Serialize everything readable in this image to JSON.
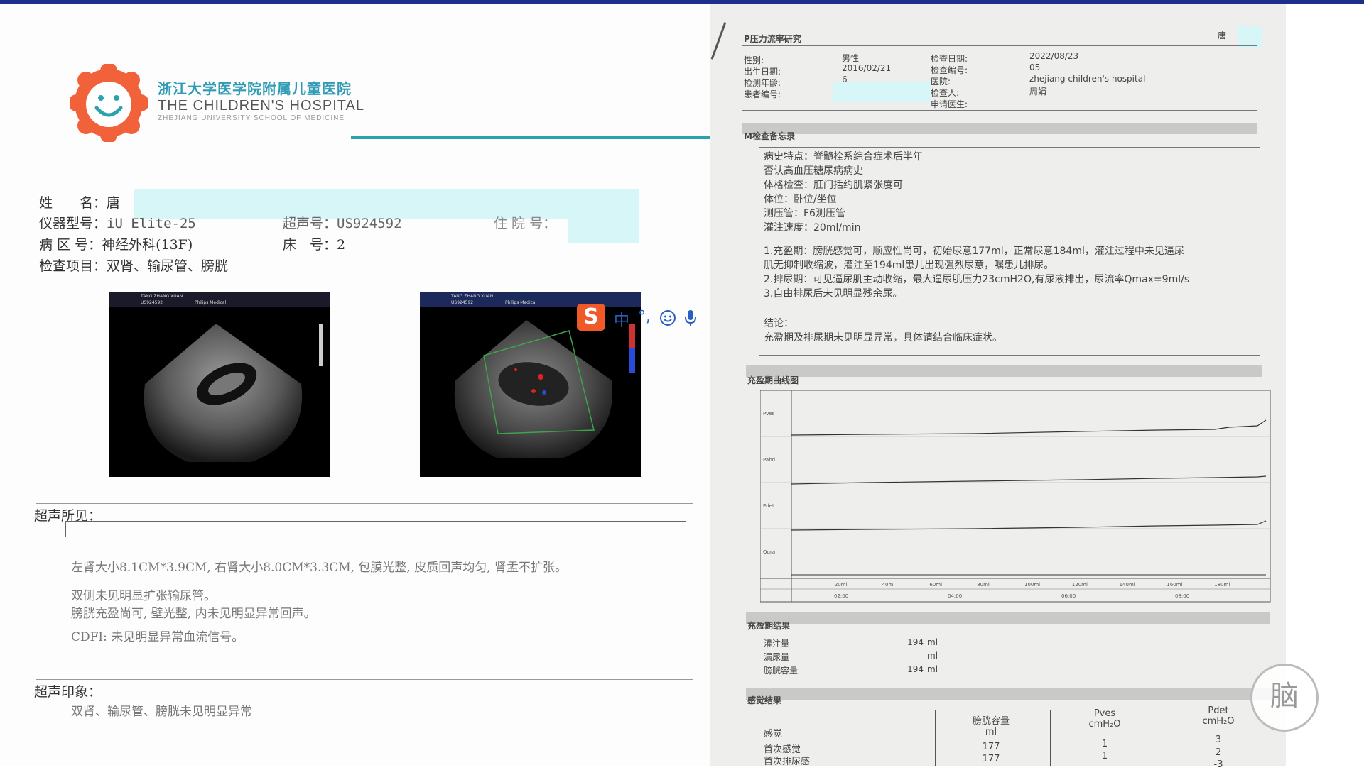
{
  "hospital": {
    "name_cn": "浙江大学医学院附属儿童医院",
    "name_en": "THE CHILDREN'S HOSPITAL",
    "school_en": "ZHEJIANG UNIVERSITY SCHOOL OF MEDICINE"
  },
  "report": {
    "name_label": "姓　　名：",
    "name_value": "唐",
    "device_label": "仪器型号：",
    "device_value": "iU Elite-25",
    "us_no_label": "超声号：",
    "us_no_value": "US924592",
    "admission_label": "住 院 号：",
    "ward_label": "病 区 号：",
    "ward_value": "神经外科(13F)",
    "bed_label": "床　号：",
    "bed_value": "2",
    "exam_label": "检查项目：",
    "exam_value": "双肾、输尿管、膀胱",
    "findings_title": "超声所见：",
    "findings": [
      "左肾大小8.1CM*3.9CM, 右肾大小8.0CM*3.3CM, 包膜光整, 皮质回声均匀, 肾盂不扩张。",
      "双侧未见明显扩张输尿管。",
      "膀胱充盈尚可, 壁光整, 内未见明显异常回声。",
      "CDFI: 未见明显异常血流信号。"
    ],
    "impression_title": "超声印象：",
    "impression": "双肾、输尿管、膀胱未见明显异常"
  },
  "ultrasound": [
    {
      "patient": "TANG ZHANG XUAN",
      "id": "US924592",
      "vendor": "Philips Medical"
    },
    {
      "patient": "TANG ZHANG XUAN",
      "id": "US924592",
      "vendor": "Philips Medical"
    }
  ],
  "ime": {
    "logo": "S",
    "lang": "中",
    "punct": "°,",
    "emoji": "smiley-icon",
    "mic": "mic-icon"
  },
  "uro": {
    "title": "P压力流率研究",
    "patient_short": "唐",
    "sex_label": "性别:",
    "sex_value": "男性",
    "dob_label": "出生日期:",
    "dob_value": "2016/02/21",
    "age_label": "检测年龄:",
    "age_value": "6",
    "pid_label": "患者编号:",
    "date_label": "检查日期:",
    "date_value": "2022/08/23",
    "no_label": "检查编号:",
    "no_value": "05",
    "hosp_label": "医院:",
    "hosp_value": "zhejiang children's hospital",
    "examiner_label": "检查人:",
    "examiner_value": "周娟",
    "doctor_label": "申请医生:",
    "record_title": "M检查备忘录",
    "record": [
      "病史特点：脊髓栓系综合症术后半年",
      "否认高血压糖尿病病史",
      "体格检查：肛门括约肌紧张度可",
      "体位：卧位/坐位",
      "测压管：F6测压管",
      "灌注速度：20ml/min"
    ],
    "record2": [
      "1.充盈期：膀胱感觉可，顺应性尚可，初始尿意177ml，正常尿意184ml，灌注过程中未见逼尿",
      "肌无抑制收缩波，灌注至194ml患儿出现强烈尿意，嘱患儿排尿。",
      "2.排尿期：可见逼尿肌主动收缩，最大逼尿肌压力23cmH2O,有尿液排出，尿流率Qmax=9ml/s",
      "3.自由排尿后未见明显残余尿。"
    ],
    "conclusion_label": "结论：",
    "conclusion": "充盈期及排尿期未见明显异常，具体请结合临床症状。",
    "chart_title": "充盈期曲线图",
    "chart_axis": [
      "Pves",
      "Pabd",
      "Pdet",
      "Qura"
    ],
    "chart_ticks": [
      "20ml",
      "40ml",
      "60ml",
      "80ml",
      "100ml",
      "120ml",
      "140ml",
      "160ml",
      "180ml"
    ],
    "chart_times": [
      "02:00",
      "04:00",
      "06:00",
      "08:00"
    ],
    "fill_title": "充盈期结果",
    "fill_rows": [
      {
        "label": "灌注量",
        "value": "194",
        "unit": "ml"
      },
      {
        "label": "漏尿量",
        "value": "-",
        "unit": "ml"
      },
      {
        "label": "膀胱容量",
        "value": "194",
        "unit": "ml"
      }
    ],
    "sense_title": "感觉结果",
    "sense_headers": [
      "感觉",
      "膀胱容量\nml",
      "Pves\ncmH₂O",
      "Pdet\ncmH₂O"
    ],
    "sense_rows": [
      [
        "首次感觉",
        "177",
        "1",
        "3"
      ],
      [
        "首次排尿感",
        "177",
        "1",
        "2"
      ]
    ],
    "sense_extra": [
      "-3"
    ]
  },
  "watermark": "脑"
}
